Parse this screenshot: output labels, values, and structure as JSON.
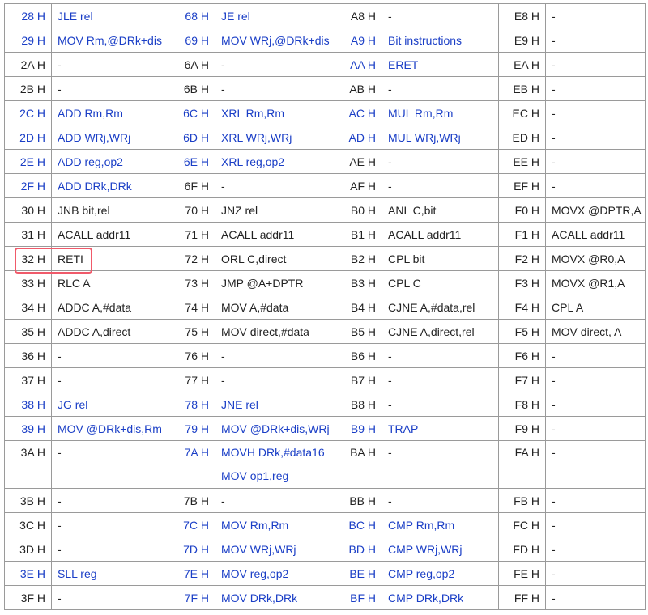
{
  "highlight_color": "#f05a6a",
  "link_color": "#1a3ec6",
  "rows": [
    {
      "cells": [
        {
          "code": "28 H",
          "mn": [
            "JLE rel"
          ],
          "blue": true
        },
        {
          "code": "68 H",
          "mn": [
            "JE rel"
          ],
          "blue": true
        },
        {
          "code": "A8 H",
          "mn": [
            "-"
          ],
          "blue": false
        },
        {
          "code": "E8 H",
          "mn": [
            "-"
          ],
          "blue": false
        }
      ]
    },
    {
      "cells": [
        {
          "code": "29 H",
          "mn": [
            "MOV Rm,@DRk+dis"
          ],
          "blue": true
        },
        {
          "code": "69 H",
          "mn": [
            "MOV WRj,@DRk+dis"
          ],
          "blue": true
        },
        {
          "code": "A9 H",
          "mn": [
            "Bit instructions"
          ],
          "blue": true
        },
        {
          "code": "E9 H",
          "mn": [
            "-"
          ],
          "blue": false
        }
      ]
    },
    {
      "cells": [
        {
          "code": "2A H",
          "mn": [
            "-"
          ],
          "blue": false
        },
        {
          "code": "6A H",
          "mn": [
            "-"
          ],
          "blue": false
        },
        {
          "code": "AA H",
          "mn": [
            "ERET"
          ],
          "blue": true
        },
        {
          "code": "EA H",
          "mn": [
            "-"
          ],
          "blue": false
        }
      ]
    },
    {
      "cells": [
        {
          "code": "2B H",
          "mn": [
            "-"
          ],
          "blue": false
        },
        {
          "code": "6B H",
          "mn": [
            "-"
          ],
          "blue": false
        },
        {
          "code": "AB H",
          "mn": [
            "-"
          ],
          "blue": false
        },
        {
          "code": "EB H",
          "mn": [
            "-"
          ],
          "blue": false
        }
      ]
    },
    {
      "cells": [
        {
          "code": "2C H",
          "mn": [
            "ADD Rm,Rm"
          ],
          "blue": true
        },
        {
          "code": "6C H",
          "mn": [
            "XRL Rm,Rm"
          ],
          "blue": true
        },
        {
          "code": "AC H",
          "mn": [
            "MUL Rm,Rm"
          ],
          "blue": true
        },
        {
          "code": "EC H",
          "mn": [
            "-"
          ],
          "blue": false
        }
      ]
    },
    {
      "cells": [
        {
          "code": "2D H",
          "mn": [
            "ADD WRj,WRj"
          ],
          "blue": true
        },
        {
          "code": "6D H",
          "mn": [
            "XRL WRj,WRj"
          ],
          "blue": true
        },
        {
          "code": "AD H",
          "mn": [
            "MUL WRj,WRj"
          ],
          "blue": true
        },
        {
          "code": "ED H",
          "mn": [
            "-"
          ],
          "blue": false
        }
      ]
    },
    {
      "cells": [
        {
          "code": "2E H",
          "mn": [
            "ADD reg,op2"
          ],
          "blue": true
        },
        {
          "code": "6E H",
          "mn": [
            "XRL reg,op2"
          ],
          "blue": true
        },
        {
          "code": "AE H",
          "mn": [
            "-"
          ],
          "blue": false
        },
        {
          "code": "EE H",
          "mn": [
            "-"
          ],
          "blue": false
        }
      ]
    },
    {
      "cells": [
        {
          "code": "2F H",
          "mn": [
            "ADD DRk,DRk"
          ],
          "blue": true
        },
        {
          "code": "6F H",
          "mn": [
            "-"
          ],
          "blue": false
        },
        {
          "code": "AF H",
          "mn": [
            "-"
          ],
          "blue": false
        },
        {
          "code": "EF H",
          "mn": [
            "-"
          ],
          "blue": false
        }
      ]
    },
    {
      "cells": [
        {
          "code": "30 H",
          "mn": [
            "JNB bit,rel"
          ],
          "blue": false
        },
        {
          "code": "70 H",
          "mn": [
            "JNZ rel"
          ],
          "blue": false
        },
        {
          "code": "B0 H",
          "mn": [
            "ANL C,bit"
          ],
          "blue": false
        },
        {
          "code": "F0 H",
          "mn": [
            "MOVX @DPTR,A"
          ],
          "blue": false
        }
      ]
    },
    {
      "cells": [
        {
          "code": "31 H",
          "mn": [
            "ACALL addr11"
          ],
          "blue": false
        },
        {
          "code": "71 H",
          "mn": [
            "ACALL addr11"
          ],
          "blue": false
        },
        {
          "code": "B1 H",
          "mn": [
            "ACALL addr11"
          ],
          "blue": false
        },
        {
          "code": "F1 H",
          "mn": [
            "ACALL addr11"
          ],
          "blue": false
        }
      ]
    },
    {
      "cells": [
        {
          "code": "32 H",
          "mn": [
            "RETI"
          ],
          "blue": false
        },
        {
          "code": "72 H",
          "mn": [
            "ORL C,direct"
          ],
          "blue": false
        },
        {
          "code": "B2 H",
          "mn": [
            "CPL bit"
          ],
          "blue": false
        },
        {
          "code": "F2 H",
          "mn": [
            "MOVX @R0,A"
          ],
          "blue": false
        }
      ]
    },
    {
      "cells": [
        {
          "code": "33 H",
          "mn": [
            "RLC A"
          ],
          "blue": false
        },
        {
          "code": "73 H",
          "mn": [
            "JMP @A+DPTR"
          ],
          "blue": false
        },
        {
          "code": "B3 H",
          "mn": [
            "CPL C"
          ],
          "blue": false
        },
        {
          "code": "F3 H",
          "mn": [
            "MOVX @R1,A"
          ],
          "blue": false
        }
      ]
    },
    {
      "cells": [
        {
          "code": "34 H",
          "mn": [
            "ADDC A,#data"
          ],
          "blue": false
        },
        {
          "code": "74 H",
          "mn": [
            "MOV A,#data"
          ],
          "blue": false
        },
        {
          "code": "B4 H",
          "mn": [
            "CJNE A,#data,rel"
          ],
          "blue": false
        },
        {
          "code": "F4 H",
          "mn": [
            "CPL A"
          ],
          "blue": false
        }
      ]
    },
    {
      "cells": [
        {
          "code": "35 H",
          "mn": [
            "ADDC A,direct"
          ],
          "blue": false
        },
        {
          "code": "75 H",
          "mn": [
            "MOV direct,#data"
          ],
          "blue": false
        },
        {
          "code": "B5 H",
          "mn": [
            "CJNE A,direct,rel"
          ],
          "blue": false
        },
        {
          "code": "F5 H",
          "mn": [
            "MOV direct, A"
          ],
          "blue": false
        }
      ]
    },
    {
      "cells": [
        {
          "code": "36 H",
          "mn": [
            "-"
          ],
          "blue": false
        },
        {
          "code": "76 H",
          "mn": [
            "-"
          ],
          "blue": false
        },
        {
          "code": "B6 H",
          "mn": [
            "-"
          ],
          "blue": false
        },
        {
          "code": "F6 H",
          "mn": [
            "-"
          ],
          "blue": false
        }
      ]
    },
    {
      "cells": [
        {
          "code": "37 H",
          "mn": [
            "-"
          ],
          "blue": false
        },
        {
          "code": "77 H",
          "mn": [
            "-"
          ],
          "blue": false
        },
        {
          "code": "B7 H",
          "mn": [
            "-"
          ],
          "blue": false
        },
        {
          "code": "F7 H",
          "mn": [
            "-"
          ],
          "blue": false
        }
      ]
    },
    {
      "cells": [
        {
          "code": "38 H",
          "mn": [
            "JG rel"
          ],
          "blue": true
        },
        {
          "code": "78 H",
          "mn": [
            "JNE rel"
          ],
          "blue": true
        },
        {
          "code": "B8 H",
          "mn": [
            "-"
          ],
          "blue": false
        },
        {
          "code": "F8 H",
          "mn": [
            "-"
          ],
          "blue": false
        }
      ]
    },
    {
      "cells": [
        {
          "code": "39 H",
          "mn": [
            "MOV @DRk+dis,Rm"
          ],
          "blue": true
        },
        {
          "code": "79 H",
          "mn": [
            "MOV @DRk+dis,WRj"
          ],
          "blue": true
        },
        {
          "code": "B9 H",
          "mn": [
            "TRAP"
          ],
          "blue": true
        },
        {
          "code": "F9 H",
          "mn": [
            "-"
          ],
          "blue": false
        }
      ]
    },
    {
      "cells": [
        {
          "code": "3A H",
          "mn": [
            "-"
          ],
          "blue": false
        },
        {
          "code": "7A H",
          "mn": [
            "MOVH DRk,#data16",
            "MOV op1,reg"
          ],
          "blue": true
        },
        {
          "code": "BA H",
          "mn": [
            "-"
          ],
          "blue": false
        },
        {
          "code": "FA H",
          "mn": [
            "-"
          ],
          "blue": false
        }
      ]
    },
    {
      "cells": [
        {
          "code": "3B H",
          "mn": [
            "-"
          ],
          "blue": false
        },
        {
          "code": "7B H",
          "mn": [
            "-"
          ],
          "blue": false
        },
        {
          "code": "BB H",
          "mn": [
            "-"
          ],
          "blue": false
        },
        {
          "code": "FB H",
          "mn": [
            "-"
          ],
          "blue": false
        }
      ]
    },
    {
      "cells": [
        {
          "code": "3C H",
          "mn": [
            "-"
          ],
          "blue": false
        },
        {
          "code": "7C H",
          "mn": [
            "MOV Rm,Rm"
          ],
          "blue": true
        },
        {
          "code": "BC H",
          "mn": [
            "CMP Rm,Rm"
          ],
          "blue": true
        },
        {
          "code": "FC H",
          "mn": [
            "-"
          ],
          "blue": false
        }
      ]
    },
    {
      "cells": [
        {
          "code": "3D H",
          "mn": [
            "-"
          ],
          "blue": false
        },
        {
          "code": "7D H",
          "mn": [
            "MOV WRj,WRj"
          ],
          "blue": true
        },
        {
          "code": "BD H",
          "mn": [
            "CMP WRj,WRj"
          ],
          "blue": true
        },
        {
          "code": "FD H",
          "mn": [
            "-"
          ],
          "blue": false
        }
      ]
    },
    {
      "cells": [
        {
          "code": "3E H",
          "mn": [
            "SLL reg"
          ],
          "blue": true
        },
        {
          "code": "7E H",
          "mn": [
            "MOV reg,op2"
          ],
          "blue": true
        },
        {
          "code": "BE H",
          "mn": [
            "CMP reg,op2"
          ],
          "blue": true
        },
        {
          "code": "FE H",
          "mn": [
            "-"
          ],
          "blue": false
        }
      ]
    },
    {
      "cells": [
        {
          "code": "3F H",
          "mn": [
            "-"
          ],
          "blue": false
        },
        {
          "code": "7F H",
          "mn": [
            "MOV DRk,DRk"
          ],
          "blue": true
        },
        {
          "code": "BF H",
          "mn": [
            "CMP DRk,DRk"
          ],
          "blue": true
        },
        {
          "code": "FF H",
          "mn": [
            "-"
          ],
          "blue": false
        }
      ]
    }
  ]
}
